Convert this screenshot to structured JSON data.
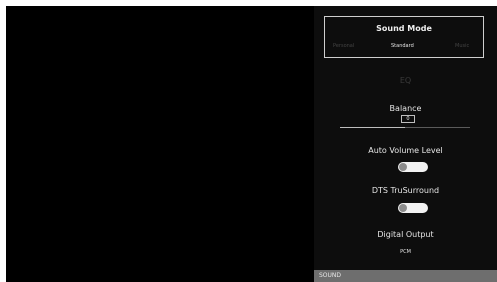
{
  "sound_mode": {
    "title": "Sound Mode",
    "options": [
      "Personal",
      "Standard",
      "Music"
    ],
    "selected": "Standard"
  },
  "eq": {
    "label": "EQ"
  },
  "balance": {
    "label": "Balance",
    "value": "0"
  },
  "auto_volume": {
    "label": "Auto Volume Level",
    "enabled": false
  },
  "dts": {
    "label": "DTS TruSurround",
    "enabled": false
  },
  "digital_output": {
    "label": "Digital Output",
    "value": "PCM"
  },
  "footer": {
    "label": "SOUND"
  }
}
